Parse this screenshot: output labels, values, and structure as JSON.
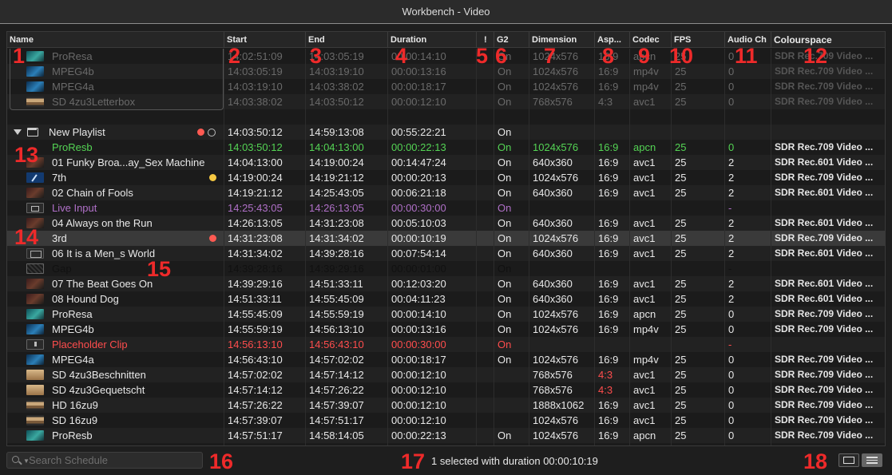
{
  "window": {
    "title": "Workbench - Video"
  },
  "columns": [
    "Name",
    "Start",
    "End",
    "Duration",
    "!",
    "G2",
    "Dimension",
    "Asp...",
    "Codec",
    "FPS",
    "Audio Ch",
    "Colourspace"
  ],
  "playlist": {
    "name": "New Playlist",
    "start": "14:03:50:12",
    "end": "14:59:13:08",
    "duration": "00:55:22:21",
    "g2": "On"
  },
  "rows": [
    {
      "kind": "clip",
      "style": "dim",
      "thumb": "teal",
      "name": "ProResa",
      "start": "14:02:51:09",
      "end": "14:03:05:19",
      "duration": "00:00:14:10",
      "g2": "On",
      "dim": "1024x576",
      "asp": "16:9",
      "codec": "apcn",
      "fps": "25",
      "audio": "0",
      "cs": "SDR Rec.709 Video ..."
    },
    {
      "kind": "clip",
      "style": "dim",
      "thumb": "blue",
      "name": "MPEG4b",
      "start": "14:03:05:19",
      "end": "14:03:19:10",
      "duration": "00:00:13:16",
      "g2": "On",
      "dim": "1024x576",
      "asp": "16:9",
      "codec": "mp4v",
      "fps": "25",
      "audio": "0",
      "cs": "SDR Rec.709 Video ..."
    },
    {
      "kind": "clip",
      "style": "dim",
      "thumb": "blue",
      "name": "MPEG4a",
      "start": "14:03:19:10",
      "end": "14:03:38:02",
      "duration": "00:00:18:17",
      "g2": "On",
      "dim": "1024x576",
      "asp": "16:9",
      "codec": "mp4v",
      "fps": "25",
      "audio": "0",
      "cs": "SDR Rec.709 Video ..."
    },
    {
      "kind": "clip",
      "style": "dim",
      "thumb": "sand",
      "name": "SD 4zu3Letterbox",
      "start": "14:03:38:02",
      "end": "14:03:50:12",
      "duration": "00:00:12:10",
      "g2": "On",
      "dim": "768x576",
      "asp": "4:3",
      "codec": "avc1",
      "fps": "25",
      "audio": "0",
      "cs": "SDR Rec.709 Video ..."
    },
    {
      "kind": "empty"
    },
    {
      "kind": "playlist"
    },
    {
      "kind": "clip",
      "style": "green",
      "thumb": "none",
      "name": "ProResb",
      "start": "14:03:50:12",
      "end": "14:04:13:00",
      "duration": "00:00:22:13",
      "g2": "On",
      "dim": "1024x576",
      "asp": "16:9",
      "codec": "apcn",
      "fps": "25",
      "audio": "0",
      "cs": "SDR Rec.709 Video ..."
    },
    {
      "kind": "clip",
      "style": "normal",
      "thumb": "dark",
      "name": "01 Funky Broa...ay_Sex Machine",
      "start": "14:04:13:00",
      "end": "14:19:00:24",
      "duration": "00:14:47:24",
      "g2": "On",
      "dim": "640x360",
      "asp": "16:9",
      "codec": "avc1",
      "fps": "25",
      "audio": "2",
      "cs": "SDR Rec.601 Video ..."
    },
    {
      "kind": "clip",
      "style": "normal",
      "thumb": "pen",
      "name": "7th",
      "start": "14:19:00:24",
      "end": "14:19:21:12",
      "duration": "00:00:20:13",
      "g2": "On",
      "dim": "1024x576",
      "asp": "16:9",
      "codec": "avc1",
      "fps": "25",
      "audio": "2",
      "cs": "SDR Rec.709 Video ...",
      "dot": "yellow"
    },
    {
      "kind": "clip",
      "style": "normal",
      "thumb": "dark",
      "name": "02 Chain of Fools",
      "start": "14:19:21:12",
      "end": "14:25:43:05",
      "duration": "00:06:21:18",
      "g2": "On",
      "dim": "640x360",
      "asp": "16:9",
      "codec": "avc1",
      "fps": "25",
      "audio": "2",
      "cs": "SDR Rec.601 Video ..."
    },
    {
      "kind": "clip",
      "style": "purple",
      "thumb": "cam",
      "name": "Live Input",
      "start": "14:25:43:05",
      "end": "14:26:13:05",
      "duration": "00:00:30:00",
      "g2": "On",
      "dim": "",
      "asp": "",
      "codec": "",
      "fps": "",
      "audio": "-",
      "cs": ""
    },
    {
      "kind": "clip",
      "style": "normal",
      "thumb": "dark",
      "name": "04 Always on the Run",
      "start": "14:26:13:05",
      "end": "14:31:23:08",
      "duration": "00:05:10:03",
      "g2": "On",
      "dim": "640x360",
      "asp": "16:9",
      "codec": "avc1",
      "fps": "25",
      "audio": "2",
      "cs": "SDR Rec.601 Video ..."
    },
    {
      "kind": "clip",
      "style": "sel",
      "thumb": "none",
      "name": "3rd",
      "start": "14:31:23:08",
      "end": "14:31:34:02",
      "duration": "00:00:10:19",
      "g2": "On",
      "dim": "1024x576",
      "asp": "16:9",
      "codec": "avc1",
      "fps": "25",
      "audio": "2",
      "cs": "SDR Rec.709 Video ...",
      "dot": "red"
    },
    {
      "kind": "clip",
      "style": "normal",
      "thumb": "film",
      "name": "06 It is a Men_s World",
      "start": "14:31:34:02",
      "end": "14:39:28:16",
      "duration": "00:07:54:14",
      "g2": "On",
      "dim": "640x360",
      "asp": "16:9",
      "codec": "avc1",
      "fps": "25",
      "audio": "2",
      "cs": "SDR Rec.601 Video ..."
    },
    {
      "kind": "clip",
      "style": "gap",
      "thumb": "gap",
      "name": "Gap",
      "start": "14:39:28:16",
      "end": "14:39:29:16",
      "duration": "00:00:01:00",
      "g2": "On",
      "dim": "",
      "asp": "",
      "codec": "",
      "fps": "",
      "audio": "-",
      "cs": ""
    },
    {
      "kind": "clip",
      "style": "normal",
      "thumb": "dark",
      "name": "07 The Beat Goes On",
      "start": "14:39:29:16",
      "end": "14:51:33:11",
      "duration": "00:12:03:20",
      "g2": "On",
      "dim": "640x360",
      "asp": "16:9",
      "codec": "avc1",
      "fps": "25",
      "audio": "2",
      "cs": "SDR Rec.601 Video ..."
    },
    {
      "kind": "clip",
      "style": "normal",
      "thumb": "dark",
      "name": "08 Hound Dog",
      "start": "14:51:33:11",
      "end": "14:55:45:09",
      "duration": "00:04:11:23",
      "g2": "On",
      "dim": "640x360",
      "asp": "16:9",
      "codec": "avc1",
      "fps": "25",
      "audio": "2",
      "cs": "SDR Rec.601 Video ..."
    },
    {
      "kind": "clip",
      "style": "normal",
      "thumb": "teal",
      "name": "ProResa",
      "start": "14:55:45:09",
      "end": "14:55:59:19",
      "duration": "00:00:14:10",
      "g2": "On",
      "dim": "1024x576",
      "asp": "16:9",
      "codec": "apcn",
      "fps": "25",
      "audio": "0",
      "cs": "SDR Rec.709 Video ..."
    },
    {
      "kind": "clip",
      "style": "normal",
      "thumb": "blue",
      "name": "MPEG4b",
      "start": "14:55:59:19",
      "end": "14:56:13:10",
      "duration": "00:00:13:16",
      "g2": "On",
      "dim": "1024x576",
      "asp": "16:9",
      "codec": "mp4v",
      "fps": "25",
      "audio": "0",
      "cs": "SDR Rec.709 Video ..."
    },
    {
      "kind": "clip",
      "style": "red",
      "thumb": "dl",
      "name": "Placeholder Clip",
      "start": "14:56:13:10",
      "end": "14:56:43:10",
      "duration": "00:00:30:00",
      "g2": "On",
      "dim": "",
      "asp": "",
      "codec": "",
      "fps": "",
      "audio": "-",
      "cs": ""
    },
    {
      "kind": "clip",
      "style": "normal",
      "thumb": "blue",
      "name": "MPEG4a",
      "start": "14:56:43:10",
      "end": "14:57:02:02",
      "duration": "00:00:18:17",
      "g2": "On",
      "dim": "1024x576",
      "asp": "16:9",
      "codec": "mp4v",
      "fps": "25",
      "audio": "0",
      "cs": "SDR Rec.709 Video ..."
    },
    {
      "kind": "clip",
      "style": "normal",
      "thumb": "sand2",
      "name": "SD 4zu3Beschnitten",
      "start": "14:57:02:02",
      "end": "14:57:14:12",
      "duration": "00:00:12:10",
      "g2": "",
      "dim": "768x576",
      "asp": "4:3",
      "asp_red": true,
      "codec": "avc1",
      "fps": "25",
      "audio": "0",
      "cs": "SDR Rec.709 Video ..."
    },
    {
      "kind": "clip",
      "style": "normal",
      "thumb": "sand2",
      "name": "SD 4zu3Gequetscht",
      "start": "14:57:14:12",
      "end": "14:57:26:22",
      "duration": "00:00:12:10",
      "g2": "",
      "dim": "768x576",
      "asp": "4:3",
      "asp_red": true,
      "codec": "avc1",
      "fps": "25",
      "audio": "0",
      "cs": "SDR Rec.709 Video ..."
    },
    {
      "kind": "clip",
      "style": "normal",
      "thumb": "sand",
      "name": "HD 16zu9",
      "start": "14:57:26:22",
      "end": "14:57:39:07",
      "duration": "00:00:12:10",
      "g2": "",
      "dim": "1888x1062",
      "asp": "16:9",
      "codec": "avc1",
      "fps": "25",
      "audio": "0",
      "cs": "SDR Rec.709 Video ..."
    },
    {
      "kind": "clip",
      "style": "normal",
      "thumb": "sand",
      "name": "SD 16zu9",
      "start": "14:57:39:07",
      "end": "14:57:51:17",
      "duration": "00:00:12:10",
      "g2": "",
      "dim": "1024x576",
      "asp": "16:9",
      "codec": "avc1",
      "fps": "25",
      "audio": "0",
      "cs": "SDR Rec.709 Video ..."
    },
    {
      "kind": "clip",
      "style": "normal",
      "thumb": "teal",
      "name": "ProResb",
      "start": "14:57:51:17",
      "end": "14:58:14:05",
      "duration": "00:00:22:13",
      "g2": "On",
      "dim": "1024x576",
      "asp": "16:9",
      "codec": "apcn",
      "fps": "25",
      "audio": "0",
      "cs": "SDR Rec.709 Video ..."
    }
  ],
  "search": {
    "placeholder": "Search Schedule"
  },
  "status": "1 selected with duration 00:00:10:19",
  "annotations": [
    "1",
    "2",
    "3",
    "4",
    "5",
    "6",
    "7",
    "8",
    "9",
    "10",
    "11",
    "12",
    "13",
    "14",
    "15",
    "16",
    "17",
    "18"
  ],
  "colors": {
    "green": "#54d454",
    "purple": "#b070c8",
    "red": "#ff4d4d",
    "annotation": "#ee2a2a"
  }
}
